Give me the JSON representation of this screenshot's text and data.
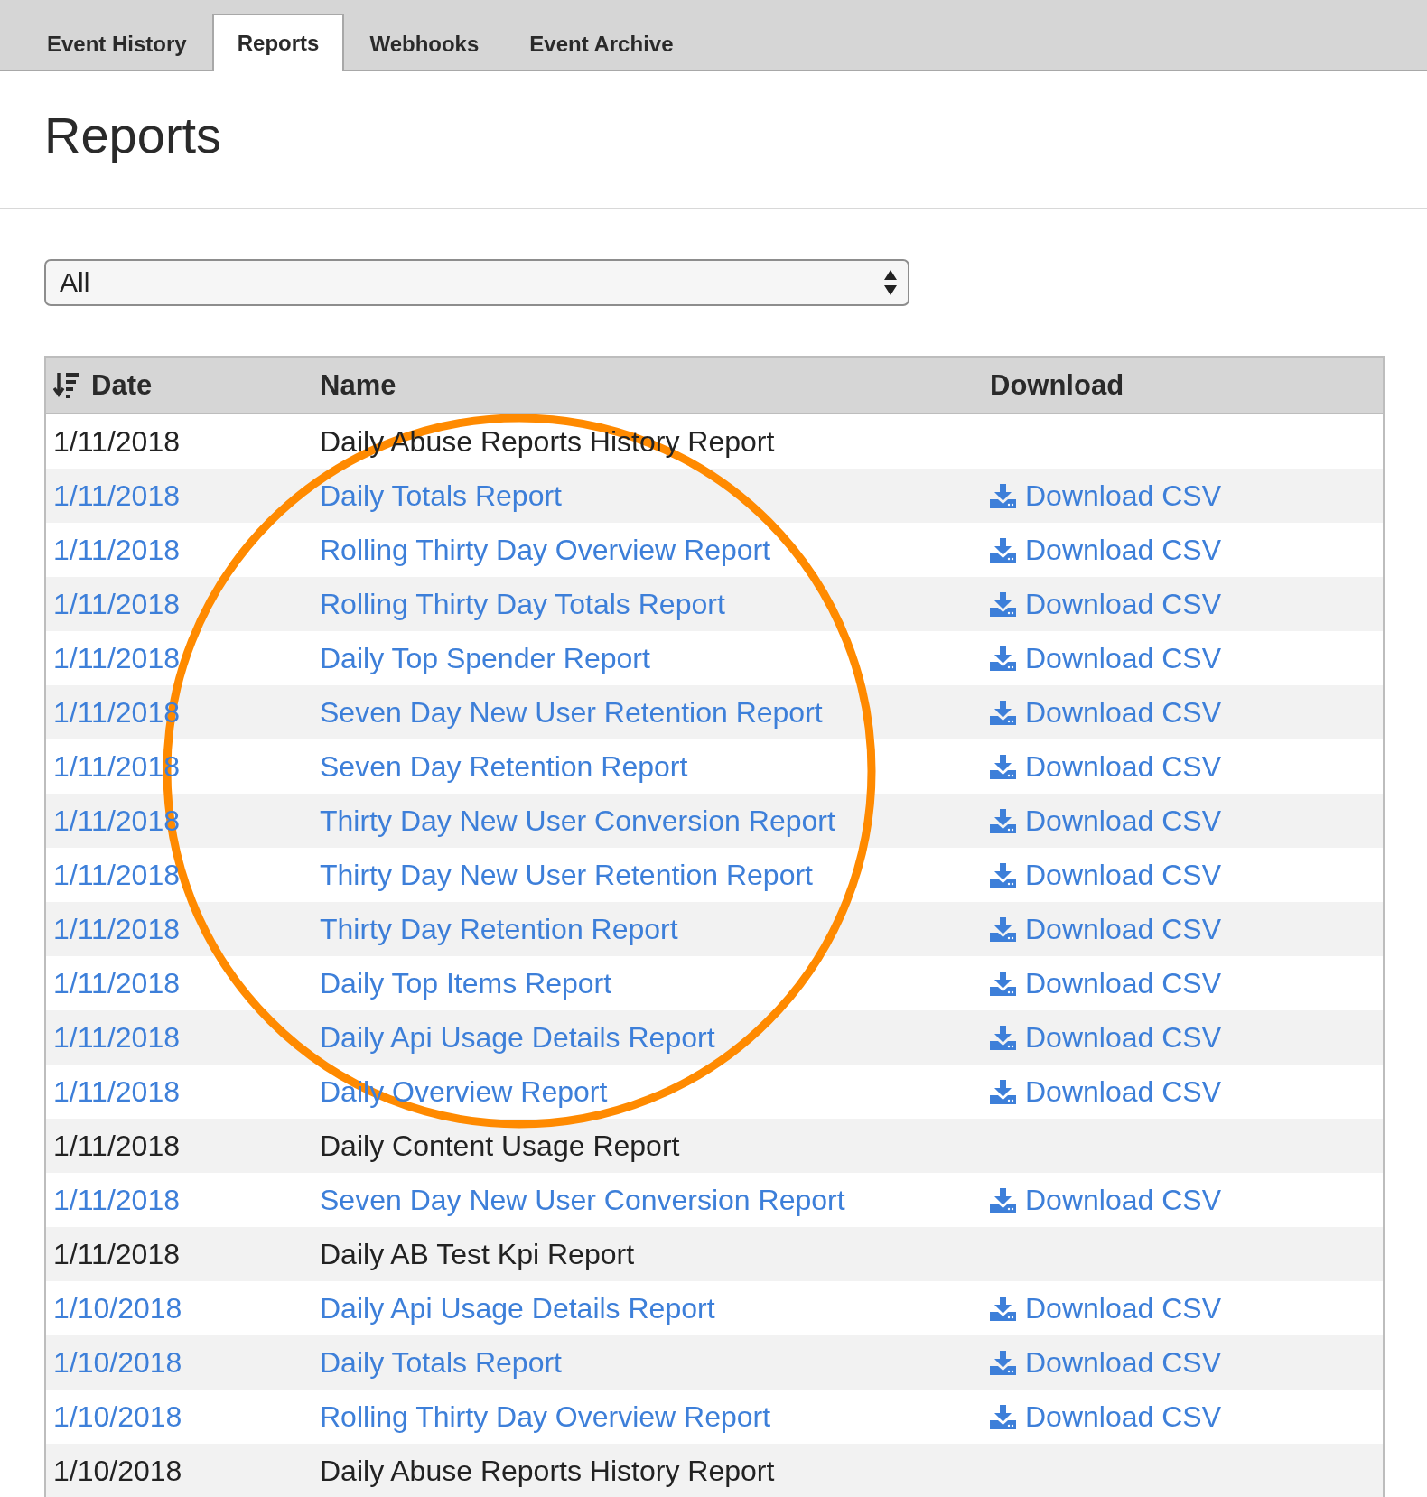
{
  "tabs": [
    {
      "label": "Event History",
      "selected": false
    },
    {
      "label": "Reports",
      "selected": true
    },
    {
      "label": "Webhooks",
      "selected": false
    },
    {
      "label": "Event Archive",
      "selected": false
    }
  ],
  "page_title": "Reports",
  "filter": {
    "value": "All"
  },
  "table": {
    "columns": [
      "Date",
      "Name",
      "Download"
    ],
    "rows": [
      {
        "date": "1/11/2018",
        "name": "Daily Abuse Reports History Report",
        "linked": false
      },
      {
        "date": "1/11/2018",
        "name": "Daily Totals Report",
        "linked": true,
        "download": "Download CSV"
      },
      {
        "date": "1/11/2018",
        "name": "Rolling Thirty Day Overview Report",
        "linked": true,
        "download": "Download CSV"
      },
      {
        "date": "1/11/2018",
        "name": "Rolling Thirty Day Totals Report",
        "linked": true,
        "download": "Download CSV"
      },
      {
        "date": "1/11/2018",
        "name": "Daily Top Spender Report",
        "linked": true,
        "download": "Download CSV"
      },
      {
        "date": "1/11/2018",
        "name": "Seven Day New User Retention Report",
        "linked": true,
        "download": "Download CSV"
      },
      {
        "date": "1/11/2018",
        "name": "Seven Day Retention Report",
        "linked": true,
        "download": "Download CSV"
      },
      {
        "date": "1/11/2018",
        "name": "Thirty Day New User Conversion Report",
        "linked": true,
        "download": "Download CSV"
      },
      {
        "date": "1/11/2018",
        "name": "Thirty Day New User Retention Report",
        "linked": true,
        "download": "Download CSV"
      },
      {
        "date": "1/11/2018",
        "name": "Thirty Day Retention Report",
        "linked": true,
        "download": "Download CSV"
      },
      {
        "date": "1/11/2018",
        "name": "Daily Top Items Report",
        "linked": true,
        "download": "Download CSV"
      },
      {
        "date": "1/11/2018",
        "name": "Daily Api Usage Details Report",
        "linked": true,
        "download": "Download CSV"
      },
      {
        "date": "1/11/2018",
        "name": "Daily Overview Report",
        "linked": true,
        "download": "Download CSV"
      },
      {
        "date": "1/11/2018",
        "name": "Daily Content Usage Report",
        "linked": false
      },
      {
        "date": "1/11/2018",
        "name": "Seven Day New User Conversion Report",
        "linked": true,
        "download": "Download CSV"
      },
      {
        "date": "1/11/2018",
        "name": "Daily AB Test Kpi Report",
        "linked": false
      },
      {
        "date": "1/10/2018",
        "name": "Daily Api Usage Details Report",
        "linked": true,
        "download": "Download CSV"
      },
      {
        "date": "1/10/2018",
        "name": "Daily Totals Report",
        "linked": true,
        "download": "Download CSV"
      },
      {
        "date": "1/10/2018",
        "name": "Rolling Thirty Day Overview Report",
        "linked": true,
        "download": "Download CSV"
      },
      {
        "date": "1/10/2018",
        "name": "Daily Abuse Reports History Report",
        "linked": false
      }
    ]
  }
}
